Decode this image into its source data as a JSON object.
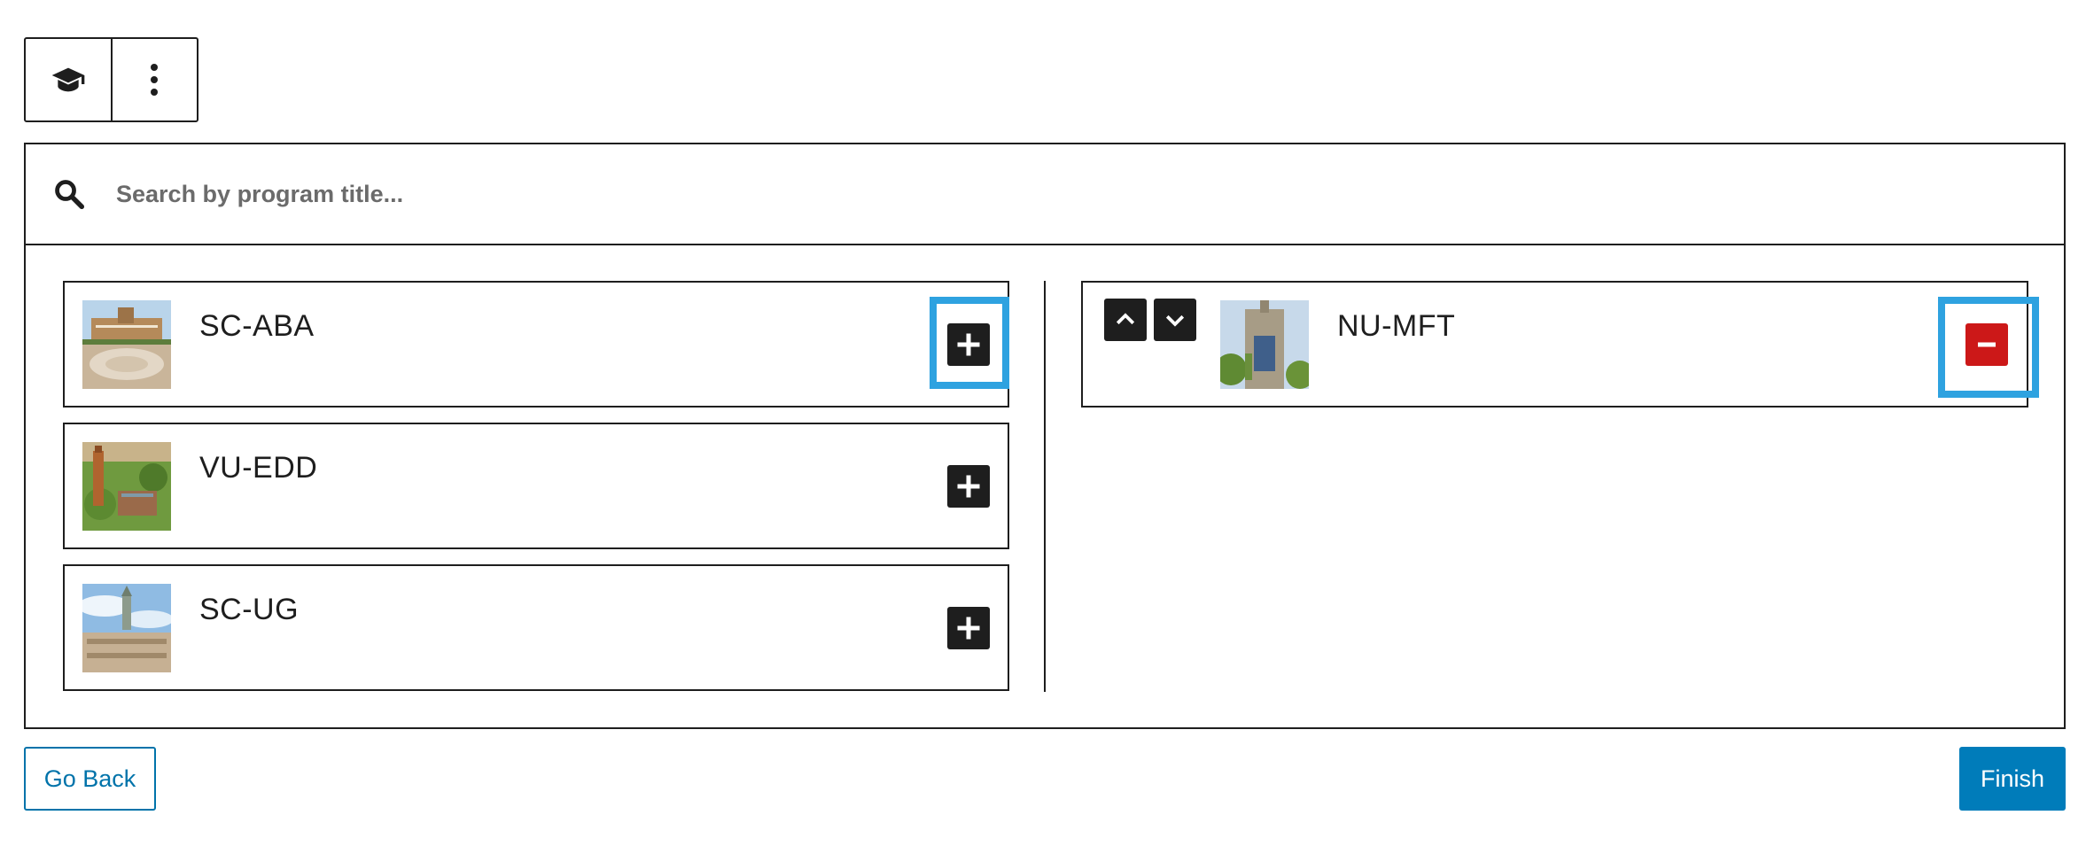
{
  "toolbar": {
    "block_icon": "graduation-cap-icon",
    "more_icon": "vertical-ellipsis-icon"
  },
  "search": {
    "placeholder": "Search by program title...",
    "value": "",
    "icon": "search-icon"
  },
  "available_programs": [
    {
      "title": "SC-ABA",
      "action_icon": "plus-icon",
      "highlighted": true
    },
    {
      "title": "VU-EDD",
      "action_icon": "plus-icon",
      "highlighted": false
    },
    {
      "title": "SC-UG",
      "action_icon": "plus-icon",
      "highlighted": false
    }
  ],
  "selected_programs": [
    {
      "title": "NU-MFT",
      "action_icon": "minus-icon",
      "highlighted": true,
      "move_up_icon": "chevron-up-icon",
      "move_down_icon": "chevron-down-icon"
    }
  ],
  "footer": {
    "go_back_label": "Go Back",
    "finish_label": "Finish"
  },
  "colors": {
    "primary": "#007cba",
    "link": "#0073aa",
    "danger": "#cc1818",
    "highlight": "#2ea2e0",
    "dark": "#1e1e1e"
  }
}
